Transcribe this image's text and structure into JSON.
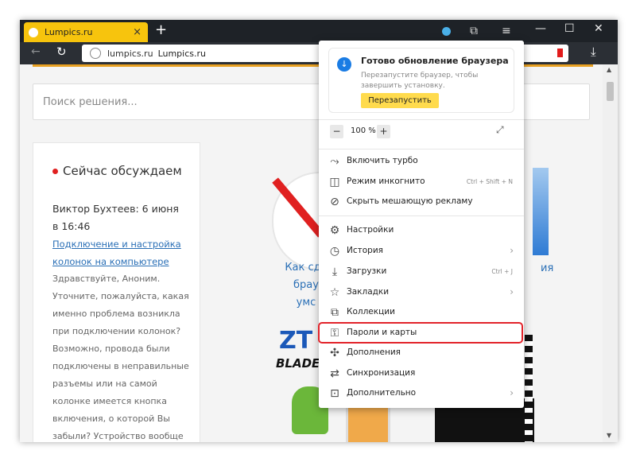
{
  "tab": {
    "title": "Lumpics.ru",
    "close": "×",
    "new": "+"
  },
  "address": {
    "host": "lumpics.ru",
    "title": "Lumpics.ru"
  },
  "page": {
    "search_placeholder": "Поиск решения...",
    "discuss_title": "Сейчас обсуждаем",
    "author": "Виктор Бухтеев: 6 июня в 16:46",
    "link": "Подключение и настройка колонок на компьютере",
    "comment": "Здравствуйте, Аноним. Уточните, пожалуйста, какая именно проблема возникла при подключении колонок? Возможно, провода были подключены в неправильные разъемы или на самой колонке имеется кнопка включения, о которой Вы забыли? Устройство вообще",
    "article_left": "Как сде брау умс",
    "article_right": "ия",
    "zte": "ZT",
    "blade": "BLADE"
  },
  "menu": {
    "update": {
      "title": "Готово обновление браузера",
      "desc": "Перезапустите браузер, чтобы завершить установку.",
      "button": "Перезапустить"
    },
    "zoom": {
      "minus": "−",
      "value": "100 %",
      "plus": "+"
    },
    "items": [
      {
        "label": "Включить турбо",
        "icon": "turbo-icon"
      },
      {
        "label": "Режим инкогнито",
        "shortcut": "Ctrl + Shift + N",
        "icon": "incognito-icon"
      },
      {
        "label": "Скрыть мешающую рекламу",
        "icon": "block-icon"
      },
      {
        "label": "Настройки",
        "icon": "gear-icon"
      },
      {
        "label": "История",
        "icon": "clock-icon",
        "submenu": true
      },
      {
        "label": "Загрузки",
        "shortcut": "Ctrl + J",
        "icon": "download-icon"
      },
      {
        "label": "Закладки",
        "icon": "star-icon",
        "submenu": true
      },
      {
        "label": "Коллекции",
        "icon": "collections-icon"
      },
      {
        "label": "Пароли и карты",
        "icon": "key-icon"
      },
      {
        "label": "Дополнения",
        "icon": "puzzle-icon"
      },
      {
        "label": "Синхронизация",
        "icon": "sync-icon"
      },
      {
        "label": "Дополнительно",
        "icon": "more-icon",
        "submenu": true
      }
    ]
  },
  "colors": {
    "accent": "#f7c40d",
    "highlight": "#e2232a",
    "link": "#2a6fb6"
  }
}
